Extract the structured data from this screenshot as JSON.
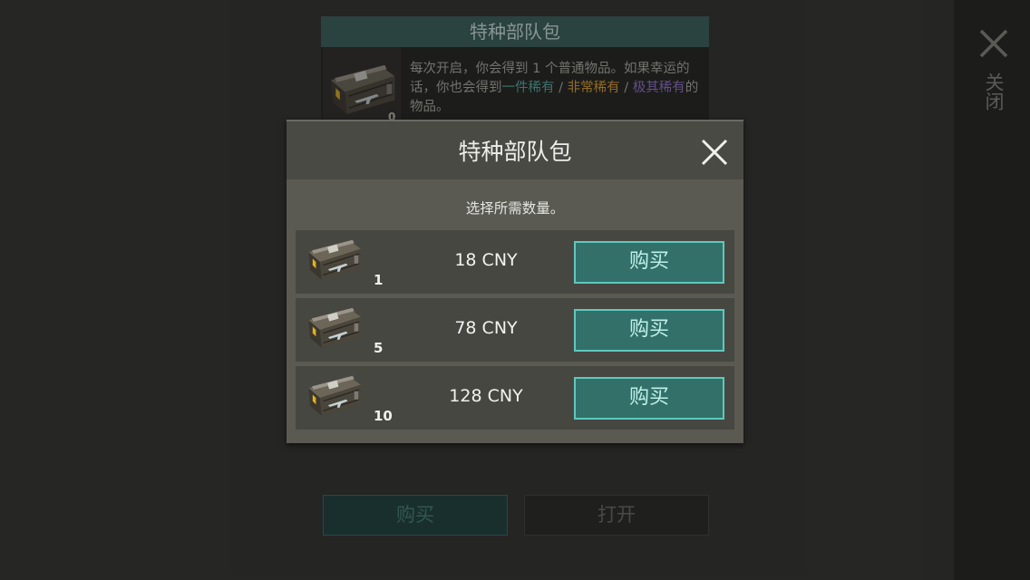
{
  "background": {
    "pack_title": "特种部队包",
    "pack_count": "0",
    "description": {
      "part1": "每次开启，你会得到 1 个普通物品。如果幸运的话，你也会得到",
      "rare": "一件稀有",
      "sep1": " / ",
      "very_rare": "非常稀有",
      "sep2": " / ",
      "extremely_rare": "极其稀有",
      "part2": "的物品。"
    },
    "buy_label": "购买",
    "open_label": "打开",
    "side_close_label": "关闭"
  },
  "modal": {
    "title": "特种部队包",
    "subtitle": "选择所需数量。",
    "options": [
      {
        "quantity": "1",
        "price": "18 CNY",
        "buy_label": "购买"
      },
      {
        "quantity": "5",
        "price": "78 CNY",
        "buy_label": "购买"
      },
      {
        "quantity": "10",
        "price": "128 CNY",
        "buy_label": "购买"
      }
    ]
  },
  "icons": {
    "close": "close-icon",
    "crate": "weapon-crate-icon"
  },
  "colors": {
    "accent": "#33706a",
    "accent_border": "#5ec9bd",
    "rare": "#4a8d86",
    "very_rare": "#b3852c",
    "extremely_rare": "#7a60a6"
  }
}
